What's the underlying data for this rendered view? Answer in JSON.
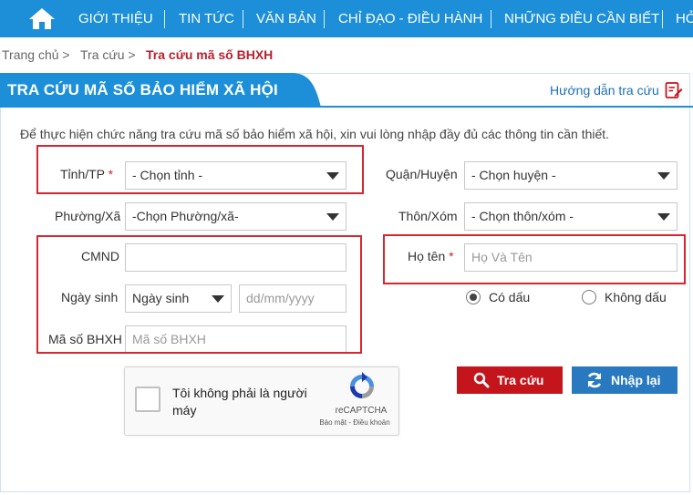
{
  "nav": {
    "items": [
      "GIỚI THIỆU",
      "TIN TỨC",
      "VĂN BẢN",
      "CHỈ ĐẠO - ĐIỀU HÀNH",
      "NHỮNG ĐIỀU CẦN BIẾT",
      "HỎ"
    ],
    "color": "#1c8fd8"
  },
  "breadcrumb": {
    "home": "Trang chủ >",
    "lookup": "Tra cứu >",
    "current": "Tra cứu mã số BHXH"
  },
  "panel": {
    "title": "TRA CỨU MÃ SỐ BẢO HIỂM XÃ HỘI",
    "guide_link": "Hướng dẫn tra cứu",
    "intro": "Để thực hiện chức năng tra cứu mã số bảo hiểm xã hội, xin vui lòng nhập đầy đủ các thông tin cần thiết."
  },
  "form": {
    "province_label": "Tỉnh/TP",
    "required_mark": "*",
    "province_value": "- Chọn tỉnh -",
    "district_label": "Quận/Huyện",
    "district_value": "- Chọn huyện -",
    "ward_label": "Phường/Xã",
    "ward_value": "-Chọn Phường/xã-",
    "village_label": "Thôn/Xóm",
    "village_value": "- Chọn thôn/xóm -",
    "id_label": "CMND",
    "id_value": "",
    "name_label": "Họ tên",
    "name_placeholder": "Họ Và Tên",
    "dob_label": "Ngày sinh",
    "dob_select": "Ngày sinh",
    "dob_placeholder": "dd/mm/yyyy",
    "code_label": "Mã số BHXH",
    "code_placeholder": "Mã số BHXH",
    "accent_option": "Có dấu",
    "no_accent_option": "Không dấu",
    "accent_selected": "Có dấu"
  },
  "captcha": {
    "text": "Tôi không phải là người máy",
    "brand": "reCAPTCHA",
    "terms": "Bảo mật - Điều khoản"
  },
  "buttons": {
    "search": "Tra cứu",
    "reset": "Nhập lại",
    "search_color": "#c4151c",
    "reset_color": "#2979c1"
  },
  "highlight_color": "#d7262f"
}
